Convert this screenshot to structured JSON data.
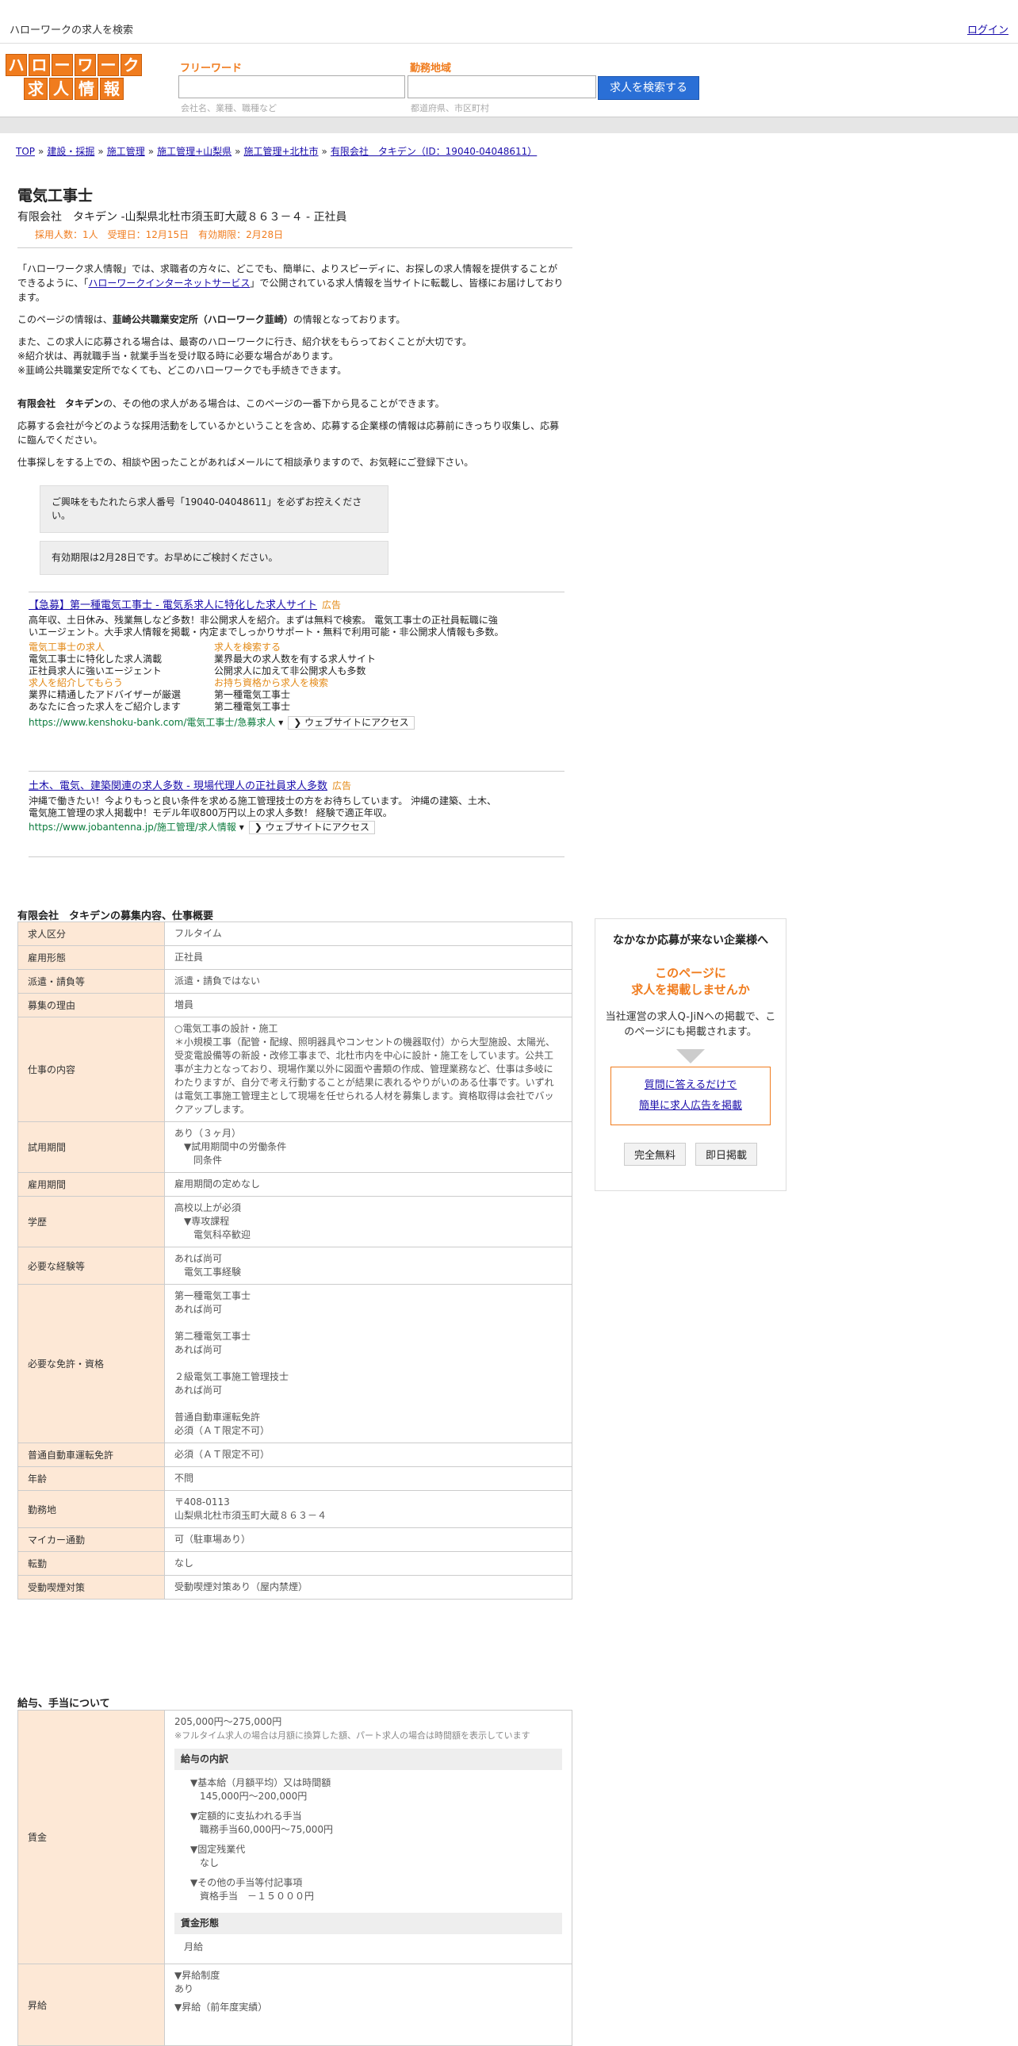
{
  "topbar": {
    "title": "ハローワークの求人を検索",
    "login": "ログイン"
  },
  "logo": {
    "row1": [
      "ハ",
      "ロ",
      "ー",
      "ワ",
      "ー",
      "ク"
    ],
    "row2": [
      "求",
      "人",
      "情",
      "報"
    ]
  },
  "search": {
    "keyword_label": "フリーワード",
    "keyword_hint": "会社名、業種、職種など",
    "area_label": "勤務地域",
    "area_hint": "都道府県、市区町村",
    "button": "求人を検索する"
  },
  "breadcrumb": [
    "TOP",
    "建設・採掘",
    "施工管理",
    "施工管理+山梨県",
    "施工管理+北杜市",
    "有限会社　タキデン（ID：19040-04048611）"
  ],
  "job": {
    "title": "電気工事士",
    "company_line": "有限会社　タキデン -山梨県北杜市須玉町大蔵８６３－４ - 正社員",
    "meta": "採用人数：1人　受理日：12月15日　有効期限：2月28日"
  },
  "intro": {
    "p1a": "「ハローワーク求人情報」では、求職者の方々に、どこでも、簡単に、よりスピーディに、お探しの求人情報を提供することができるように、「",
    "p1link": "ハローワークインターネットサービス",
    "p1b": "」で公開されている求人情報を当サイトに転載し、皆様にお届けしております。",
    "p2a": "このページの情報は、",
    "p2b": "韮崎公共職業安定所（ハローワーク韮崎）",
    "p2c": "の情報となっております。",
    "p3": "また、この求人に応募される場合は、最寄のハローワークに行き、紹介状をもらっておくことが大切です。",
    "p3b": "※紹介状は、再就職手当・就業手当を受け取る時に必要な場合があります。",
    "p3c": "※韮崎公共職業安定所でなくても、どこのハローワークでも手続きできます。",
    "p4a": "有限会社　タキデン",
    "p4b": "の、その他の求人がある場合は、このページの一番下から見ることができます。",
    "p5": "応募する会社が今どのような採用活動をしているかということを含め、応募する企業様の情報は応募前にきっちり収集し、応募に臨んでください。",
    "p6": "仕事探しをする上での、相談や困ったことがあればメールにて相談承りますので、お気軽にご登録下さい。",
    "note1": "ご興味をもたれたら求人番号「19040-04048611」を必ずお控えください。",
    "note2": "有効期限は2月28日です。お早めにご検討ください。"
  },
  "ad1": {
    "title": "【急募】第一種電気工事士 - 電気系求人に特化した求人サイト",
    "label": "広告",
    "desc": "高年収、土日休み、残業無しなど多数！非公開求人を紹介。まずは無料で検索。 電気工事士の正社員転職に強いエージェント。大手求人情報を掲載・内定までしっかりサポート・無料で利用可能・非公開求人情報も多数。",
    "sub": [
      {
        "title": "電気工事士の求人",
        "lines": [
          "電気工事士に特化した求人満載",
          "正社員求人に強いエージェント"
        ]
      },
      {
        "title": "求人を検索する",
        "lines": [
          "業界最大の求人数を有する求人サイト",
          "公開求人に加えて非公開求人も多数"
        ]
      },
      {
        "title": "求人を紹介してもらう",
        "lines": [
          "業界に精通したアドバイザーが厳選",
          "あなたに合った求人をご紹介します"
        ]
      },
      {
        "title": "お持ち資格から求人を検索",
        "lines": [
          "第一種電気工事士",
          "第二種電気工事士"
        ]
      }
    ],
    "url": "https://www.kenshoku-bank.com/電気工事士/急募求人",
    "visit": "❯ ウェブサイトにアクセス"
  },
  "ad2": {
    "title": "土木、電気、建築関連の求人多数 - 現場代理人の正社員求人多数",
    "label": "広告",
    "desc": "沖縄で働きたい！今よりもっと良い条件を求める施工管理技士の方をお待ちしています。 沖縄の建築、土木、電気施工管理の求人掲載中！モデル年収800万円以上の求人多数！ 経験で適正年収。",
    "url": "https://www.jobantenna.jp/施工管理/求人情報",
    "visit": "❯ ウェブサイトにアクセス"
  },
  "section1_title": "有限会社　タキデンの募集内容、仕事概要",
  "spec": [
    {
      "k": "求人区分",
      "v": "フルタイム"
    },
    {
      "k": "雇用形態",
      "v": "正社員"
    },
    {
      "k": "派遣・請負等",
      "v": "派遣・請負ではない"
    },
    {
      "k": "募集の理由",
      "v": "増員"
    },
    {
      "k": "仕事の内容",
      "v": "○電気工事の設計・施工\n＊小規模工事（配管・配線、照明器具やコンセントの機器取付）から大型施設、太陽光、受変電設備等の新設・改修工事まで、北杜市内を中心に設計・施工をしています。公共工事が主力となっており、現場作業以外に図面や書類の作成、管理業務など、仕事は多岐にわたりますが、自分で考え行動することが結果に表れるやりがいのある仕事です。いずれは電気工事施工管理主として現場を任せられる人材を募集します。資格取得は会社でバックアップします。"
    },
    {
      "k": "試用期間",
      "v": "あり（３ヶ月）\n　▼試用期間中の労働条件\n　　同条件"
    },
    {
      "k": "雇用期間",
      "v": "雇用期間の定めなし"
    },
    {
      "k": "学歴",
      "v": "高校以上が必須\n　▼専攻課程\n　　電気科卒歓迎"
    },
    {
      "k": "必要な経験等",
      "v": "あれば尚可\n　電気工事経験"
    },
    {
      "k": "必要な免許・資格",
      "v": "第一種電気工事士\nあれば尚可\n\n第二種電気工事士\nあれば尚可\n\n２級電気工事施工管理技士\nあれば尚可\n\n普通自動車運転免許\n必須（ＡＴ限定不可）"
    },
    {
      "k": "普通自動車運転免許",
      "v": "必須（ＡＴ限定不可）"
    },
    {
      "k": "年齢",
      "v": "不問"
    },
    {
      "k": "勤務地",
      "v": "〒408-0113\n山梨県北杜市須玉町大蔵８６３－４"
    },
    {
      "k": "マイカー通勤",
      "v": "可（駐車場あり）"
    },
    {
      "k": "転勤",
      "v": "なし"
    },
    {
      "k": "受動喫煙対策",
      "v": "受動喫煙対策あり（屋内禁煙）"
    }
  ],
  "section2_title": "給与、手当について",
  "salary": {
    "k": "賃金",
    "range": "205,000円〜275,000円",
    "note": "※フルタイム求人の場合は月額に換算した額、パート求人の場合は時間額を表示しています",
    "breakdown_head": "給与の内訳",
    "items": [
      "▼基本給（月額平均）又は時間額\n　145,000円〜200,000円",
      "▼定額的に支払われる手当\n　職務手当60,000円〜75,000円",
      "▼固定残業代\n　なし",
      "▼その他の手当等付記事項\n　資格手当　－１５０００円"
    ],
    "form_head": "賃金形態",
    "form": "月給"
  },
  "raise": {
    "k": "昇給",
    "lines": [
      "▼昇給制度\nあり",
      "▼昇給（前年度実績）"
    ]
  },
  "sidebox": {
    "t1": "なかなか応募が来ない企業様へ",
    "t2a": "このページに",
    "t2b": "求人を掲載しませんか",
    "t3": "当社運営の求人Q-JiNへの掲載で、このページにも掲載されます。",
    "link1": "質問に答えるだけで",
    "link2": "簡単に求人広告を掲載",
    "btn1": "完全無料",
    "btn2": "即日掲載"
  }
}
